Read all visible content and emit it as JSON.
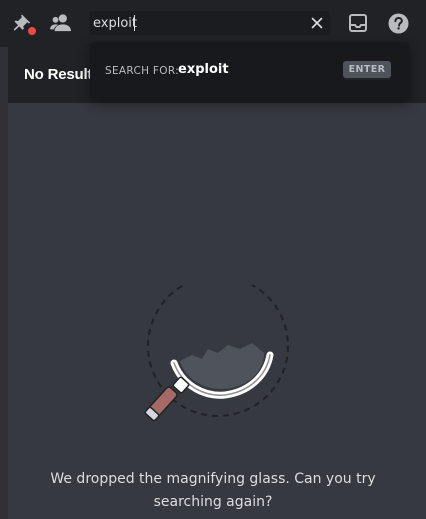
{
  "toolbar": {
    "pinned_icon": "pin-icon",
    "members_icon": "members-icon",
    "inbox_icon": "inbox-icon",
    "help_icon": "help-icon",
    "notification_color": "#f04747"
  },
  "search": {
    "value": "exploit",
    "clear_icon": "close-icon"
  },
  "results": {
    "title": "No Result"
  },
  "popout": {
    "prefix": "SEARCH FOR:",
    "query": "exploit",
    "enter_label": "ENTER"
  },
  "empty_state": {
    "message": "We dropped the magnifying glass. Can you try searching again?",
    "illustration": "broken-magnifying-glass"
  },
  "colors": {
    "background": "#36393f",
    "toolbar": "#202225",
    "popout": "#18191c",
    "text": "#dcddde"
  }
}
